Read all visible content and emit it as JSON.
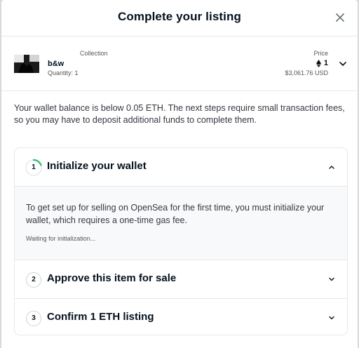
{
  "modal": {
    "title": "Complete your listing"
  },
  "item": {
    "collection_header": "Collection",
    "name": "b&w",
    "quantity": "Quantity: 1",
    "price_header": "Price",
    "price_eth": "1",
    "price_usd": "$3,061.76 USD"
  },
  "notice": "Your wallet balance is below 0.05 ETH. The next steps require small transaction fees, so you may have to deposit additional funds to complete them.",
  "steps": [
    {
      "number": "1",
      "label": "Initialize your wallet",
      "description": "To get set up for selling on OpenSea for the first time, you must initialize your wallet, which requires a one-time gas fee.",
      "status": "Waiting for initialization..."
    },
    {
      "number": "2",
      "label": "Approve this item for sale"
    },
    {
      "number": "3",
      "label": "Confirm 1 ETH listing"
    }
  ],
  "colors": {
    "progress_accent": "#2ebd6e",
    "text_primary": "#04111d",
    "border": "#e5e8eb"
  },
  "icons": [
    "close-icon",
    "chevron-down-icon",
    "chevron-up-icon",
    "ethereum-icon"
  ]
}
